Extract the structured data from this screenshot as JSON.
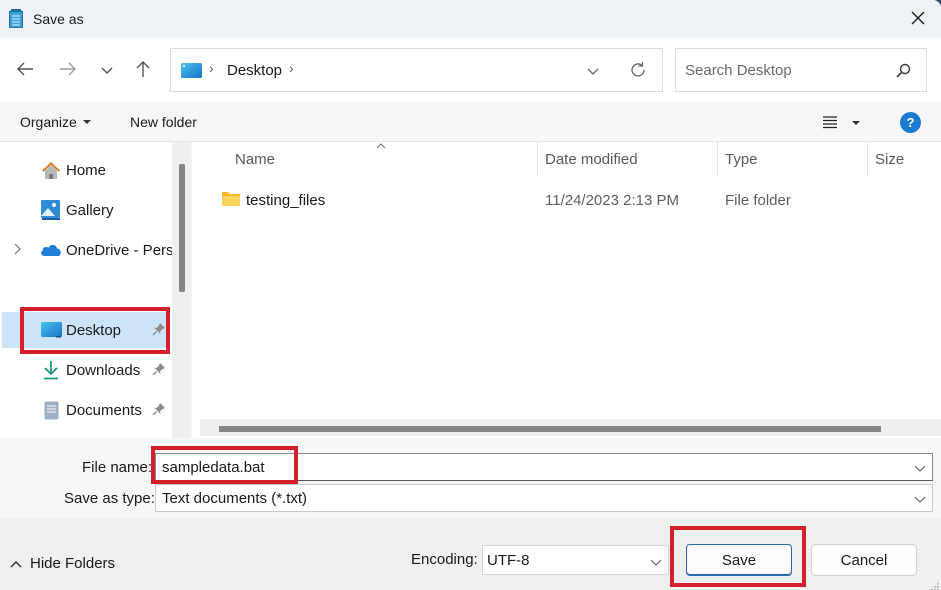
{
  "window": {
    "title": "Save as",
    "app_icon": "notepad-icon",
    "close_icon": "close-icon"
  },
  "nav": {
    "back_icon": "arrow-left-icon",
    "forward_icon": "arrow-right-icon",
    "recent_icon": "chevron-down-icon",
    "up_icon": "arrow-up-icon",
    "address": {
      "location_icon": "desktop-folder-icon",
      "path": [
        "Desktop"
      ],
      "dropdown_icon": "chevron-down-icon",
      "refresh_icon": "refresh-icon"
    },
    "search": {
      "placeholder": "Search Desktop",
      "value": "",
      "icon": "search-icon"
    }
  },
  "command_bar": {
    "organize_label": "Organize",
    "new_folder_label": "New folder",
    "view_icon": "list-view-icon",
    "help_label": "?"
  },
  "sidebar": {
    "items": [
      {
        "label": "Home",
        "icon": "home-icon",
        "pinned": false,
        "expandable": false,
        "selected": false
      },
      {
        "label": "Gallery",
        "icon": "gallery-icon",
        "pinned": false,
        "expandable": false,
        "selected": false
      },
      {
        "label": "OneDrive - Perso",
        "icon": "onedrive-cloud-icon",
        "pinned": false,
        "expandable": true,
        "selected": false
      },
      {
        "label": "Desktop",
        "icon": "desktop-folder-icon",
        "pinned": true,
        "expandable": false,
        "selected": true
      },
      {
        "label": "Downloads",
        "icon": "download-icon",
        "pinned": true,
        "expandable": false,
        "selected": false
      },
      {
        "label": "Documents",
        "icon": "documents-icon",
        "pinned": true,
        "expandable": false,
        "selected": false
      }
    ]
  },
  "file_list": {
    "columns": [
      "Name",
      "Date modified",
      "Type",
      "Size"
    ],
    "sort_column": "Name",
    "sort_direction": "ascending",
    "rows": [
      {
        "name": "testing_files",
        "date_modified": "11/24/2023 2:13 PM",
        "type": "File folder",
        "size": "",
        "icon": "folder-icon"
      }
    ]
  },
  "form": {
    "file_name_label": "File name:",
    "file_name_value": "sampledata.bat",
    "save_type_label": "Save as type:",
    "save_type_value": "Text documents (*.txt)"
  },
  "footer": {
    "hide_folders_label": "Hide Folders",
    "encoding_label": "Encoding:",
    "encoding_value": "UTF-8",
    "save_label": "Save",
    "cancel_label": "Cancel"
  },
  "annotations": {
    "highlight_color": "#d4202c",
    "highlighted": [
      "Desktop",
      "File name",
      "Save"
    ]
  }
}
